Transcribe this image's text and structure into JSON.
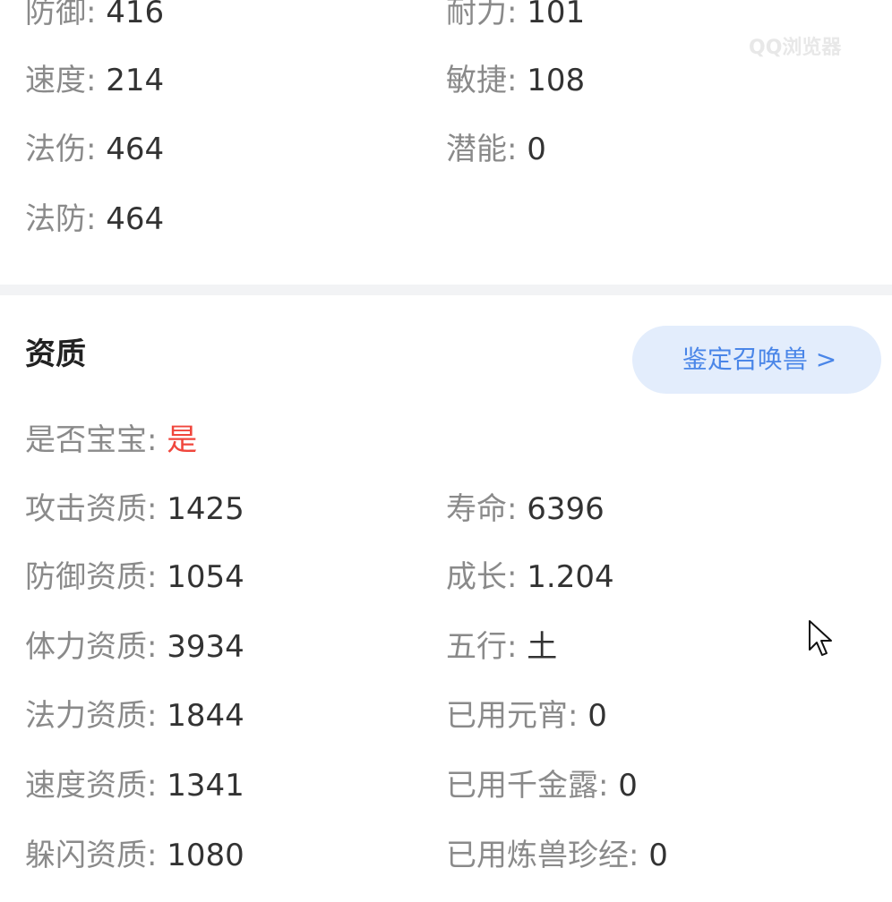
{
  "attributes": {
    "defense": {
      "label": "防御:",
      "value": "416"
    },
    "endurance": {
      "label": "耐力:",
      "value": "101"
    },
    "speed": {
      "label": "速度:",
      "value": "214"
    },
    "agility": {
      "label": "敏捷:",
      "value": "108"
    },
    "magic_damage": {
      "label": "法伤:",
      "value": "464"
    },
    "potential": {
      "label": "潜能:",
      "value": "0"
    },
    "magic_defense": {
      "label": "法防:",
      "value": "464"
    }
  },
  "aptitude": {
    "title": "资质",
    "appraise_button": "鉴定召唤兽 >",
    "is_baby": {
      "label": "是否宝宝:",
      "value": "是"
    },
    "left": [
      {
        "label": "攻击资质:",
        "value": "1425"
      },
      {
        "label": "防御资质:",
        "value": "1054"
      },
      {
        "label": "体力资质:",
        "value": "3934"
      },
      {
        "label": "法力资质:",
        "value": "1844"
      },
      {
        "label": "速度资质:",
        "value": "1341"
      },
      {
        "label": "躲闪资质:",
        "value": "1080"
      }
    ],
    "right": [
      {
        "label": "寿命:",
        "value": "6396"
      },
      {
        "label": "成长:",
        "value": "1.204"
      },
      {
        "label": "五行:",
        "value": "土"
      },
      {
        "label": "已用元宵:",
        "value": "0"
      },
      {
        "label": "已用千金露:",
        "value": "0"
      },
      {
        "label": "已用炼兽珍经:",
        "value": "0"
      }
    ]
  },
  "watermark": "QQ浏览器",
  "colors": {
    "label": "#8a8a8a",
    "value": "#333333",
    "highlight": "#f0463c",
    "button_bg": "#e3edfc",
    "button_text": "#4a86e8"
  }
}
